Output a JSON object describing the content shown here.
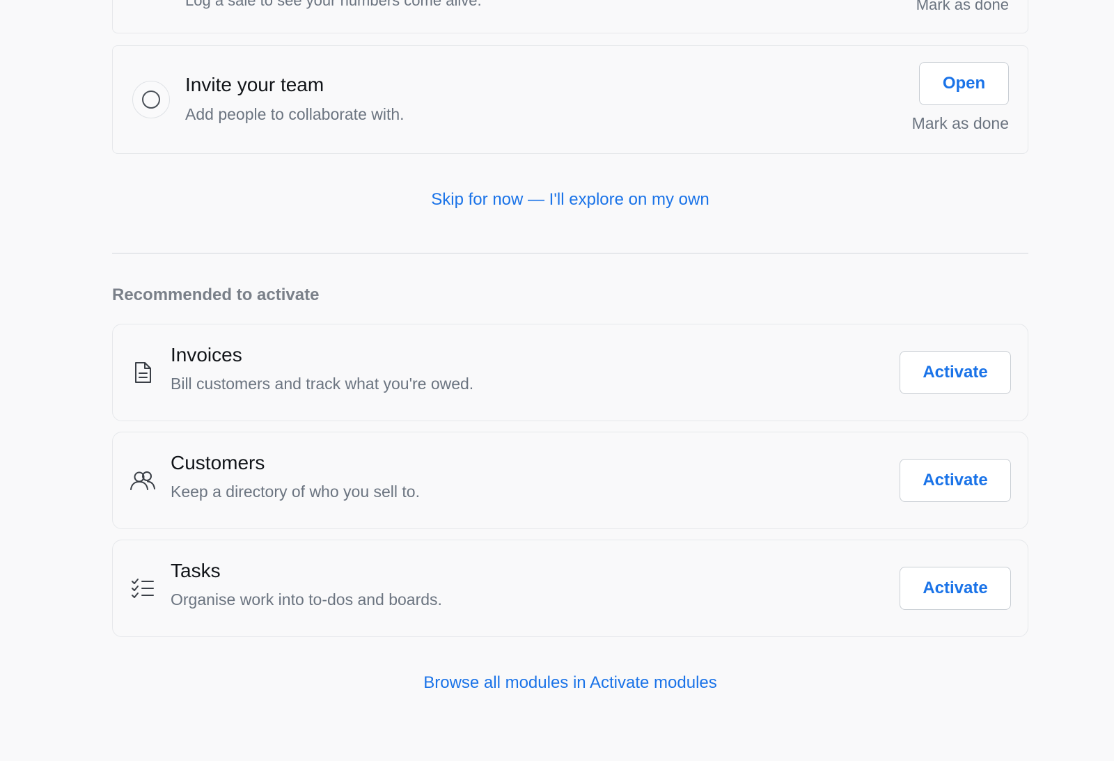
{
  "previous_step": {
    "desc": "Log a sale to see your numbers come alive.",
    "mark_done": "Mark as done"
  },
  "invite_step": {
    "title": "Invite your team",
    "desc": "Add people to collaborate with.",
    "open_label": "Open",
    "mark_done": "Mark as done"
  },
  "skip_link": "Skip for now — I'll explore on my own",
  "recommended": {
    "heading": "Recommended to activate",
    "modules": [
      {
        "title": "Invoices",
        "desc": "Bill customers and track what you're owed.",
        "icon": "document-icon",
        "action": "Activate"
      },
      {
        "title": "Customers",
        "desc": "Keep a directory of who you sell to.",
        "icon": "users-icon",
        "action": "Activate"
      },
      {
        "title": "Tasks",
        "desc": "Organise work into to-dos and boards.",
        "icon": "checklist-icon",
        "action": "Activate"
      }
    ]
  },
  "browse_link": "Browse all modules in Activate modules",
  "colors": {
    "accent": "#1a73e8",
    "background": "#f9f9fa",
    "border": "#e6e8eb",
    "muted_text": "#6b7480"
  }
}
